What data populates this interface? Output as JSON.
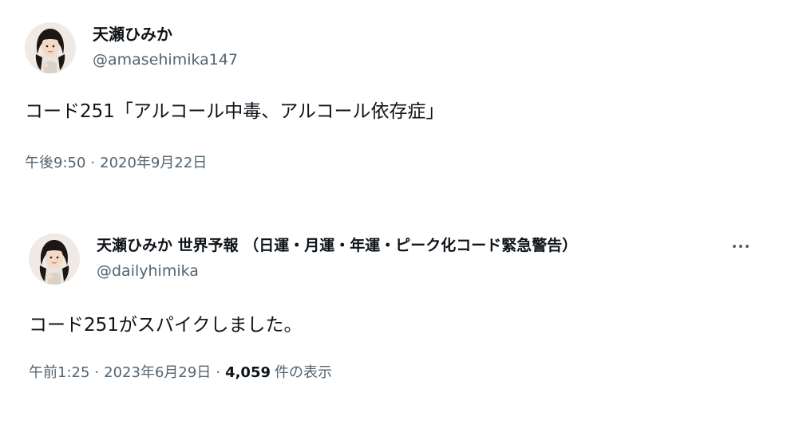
{
  "tweets": [
    {
      "display_name": "天瀬ひみか",
      "handle": "@amasehimika147",
      "text": "コード251「アルコール中毒、アルコール依存症」",
      "time": "午後9:50",
      "date": "2020年9月22日",
      "avatar_icon": "user-avatar"
    },
    {
      "display_name": "天瀬ひみか 世界予報 （日運・月運・年運・ピーク化コード緊急警告）",
      "handle": "@dailyhimika",
      "text": "コード251がスパイクしました。",
      "time": "午前1:25",
      "date": "2023年6月29日",
      "views_count": "4,059",
      "views_label": "件の表示",
      "more_icon": "more-horizontal-icon",
      "avatar_icon": "user-avatar"
    }
  ],
  "separator": "·",
  "colors": {
    "text_primary": "#0f1419",
    "text_secondary": "#536471",
    "background": "#ffffff"
  }
}
